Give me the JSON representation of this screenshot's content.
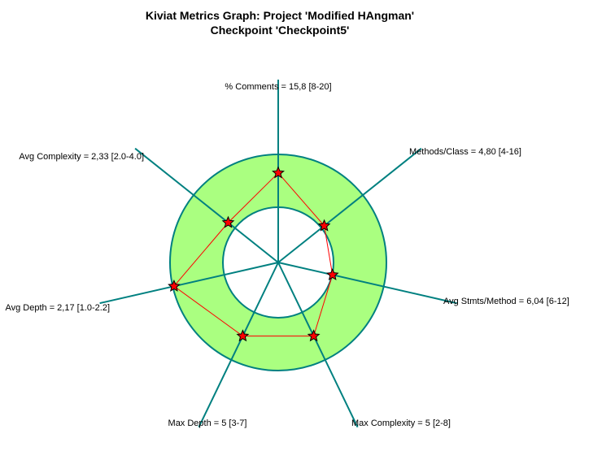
{
  "chart_data": {
    "type": "kiviat",
    "title_lines": [
      "Kiviat Metrics Graph: Project 'Modified HAngman'",
      "Checkpoint 'Checkpoint5'"
    ],
    "axes": [
      {
        "label": "% Comments = 15,8 [8-20]",
        "value": 15.8,
        "min": 8,
        "max": 20
      },
      {
        "label": "Methods/Class = 4,80 [4-16]",
        "value": 4.8,
        "min": 4,
        "max": 16
      },
      {
        "label": "Avg Stmts/Method = 6,04 [6-12]",
        "value": 6.04,
        "min": 6,
        "max": 12
      },
      {
        "label": "Max Complexity = 5 [2-8]",
        "value": 5,
        "min": 2,
        "max": 8
      },
      {
        "label": "Max Depth = 5 [3-7]",
        "value": 5,
        "min": 3,
        "max": 7
      },
      {
        "label": "Avg Depth = 2,17 [1.0-2.2]",
        "value": 2.17,
        "min": 1.0,
        "max": 2.2
      },
      {
        "label": "Avg Complexity = 2,33 [2.0-4.0]",
        "value": 2.33,
        "min": 2.0,
        "max": 4.0
      }
    ],
    "colors": {
      "band_fill": "#aaff80",
      "ring_stroke": "#008080",
      "axis_stroke": "#008080",
      "polygon_stroke": "#ff0000",
      "marker_fill": "#ff0000",
      "marker_stroke": "#000000"
    }
  }
}
